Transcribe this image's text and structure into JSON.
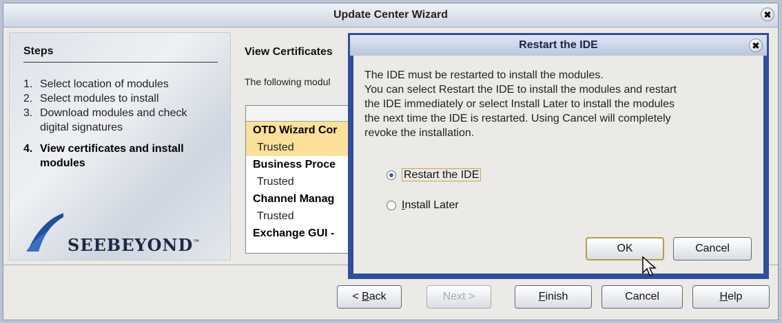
{
  "wizard": {
    "title": "Update Center Wizard",
    "close_glyph": "✖"
  },
  "steps": {
    "title": "Steps",
    "items": [
      {
        "num": "1.",
        "label": "Select location of modules"
      },
      {
        "num": "2.",
        "label": "Select modules to install"
      },
      {
        "num": "3.",
        "label": "Download modules and check digital signatures"
      },
      {
        "num": "4.",
        "label": "View certificates and install modules",
        "current": true
      }
    ]
  },
  "logo": {
    "text": "SEEBEYOND",
    "tm": "™"
  },
  "main": {
    "title": "View Certificates",
    "description": "The following modul",
    "list": [
      {
        "name": "OTD Wizard Cor",
        "status": "Trusted",
        "selected": true
      },
      {
        "name": "Business Proce",
        "status": "Trusted"
      },
      {
        "name": "Channel Manag",
        "status": "Trusted"
      },
      {
        "name": "Exchange GUI -"
      }
    ]
  },
  "buttons": {
    "back": "< Back",
    "back_key": "B",
    "next": "Next >",
    "finish": "Finish",
    "finish_key": "F",
    "cancel": "Cancel",
    "help": "Help",
    "help_key": "H"
  },
  "dialog": {
    "title": "Restart the IDE",
    "close_glyph": "✖",
    "message_lines": [
      "The IDE must be restarted to install the modules.",
      "You can select Restart the IDE to install the modules and restart",
      "the IDE immediately or select Install Later to install the modules",
      "the next time the IDE is restarted. Using Cancel will completely",
      "revoke the installation."
    ],
    "options": [
      {
        "label": "Restart the IDE",
        "selected": true
      },
      {
        "label": "Install Later",
        "key": "I",
        "selected": false
      }
    ],
    "ok": "OK",
    "cancel": "Cancel"
  },
  "colors": {
    "dialog_border": "#2f4f9c",
    "selection": "#fbe09a",
    "logo_blue": "#1f4fa0"
  }
}
